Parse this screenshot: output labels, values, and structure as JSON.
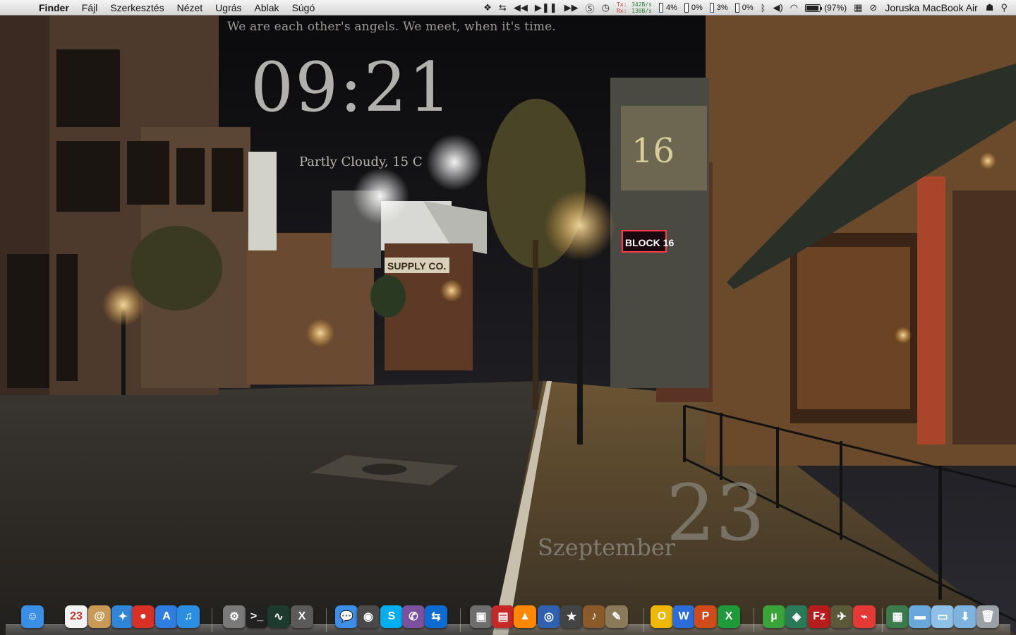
{
  "menubar": {
    "app": "Finder",
    "menus": [
      "Fájl",
      "Szerkesztés",
      "Nézet",
      "Ugrás",
      "Ablak",
      "Súgó"
    ],
    "network": {
      "tx_label": "Tx:",
      "tx_value": "342B/s",
      "rx_label": "Rx:",
      "rx_value": "130B/s"
    },
    "meters": [
      {
        "value": "4%",
        "fill": 0.04
      },
      {
        "value": "0%",
        "fill": 0.0
      },
      {
        "value": "3%",
        "fill": 0.03
      },
      {
        "value": "0%",
        "fill": 0.0
      }
    ],
    "battery": "(97%)",
    "battery_level": 0.97,
    "machine_name": "Joruska MacBook Air",
    "icons": [
      "dropbox-icon",
      "teamviewer-icon",
      "rewind-icon",
      "play-pause-icon",
      "forward-icon",
      "skype-status-icon",
      "time-machine-icon",
      "bluetooth-icon",
      "volume-icon",
      "wifi-icon",
      "calendar-icon",
      "do-not-disturb-icon",
      "user-icon",
      "spotlight-icon"
    ]
  },
  "desktop": {
    "quote": "We are each other's angels. We meet, when it's time.",
    "clock": "09:21",
    "weather": "Partly Cloudy, 15 C",
    "month": "Szeptember",
    "day": "23"
  },
  "dock": {
    "items": [
      {
        "name": "finder-icon",
        "color": "#3a8ee6",
        "glyph": "☺"
      },
      {
        "name": "calendar-icon",
        "color": "#f2f2f2",
        "glyph": "23"
      },
      {
        "name": "address-book-icon",
        "color": "#c89a55",
        "glyph": "@"
      },
      {
        "name": "safari-icon",
        "color": "#2f86d6",
        "glyph": "✦"
      },
      {
        "name": "chrome-icon",
        "color": "#d93025",
        "glyph": "●"
      },
      {
        "name": "app-store-icon",
        "color": "#2f7de0",
        "glyph": "A"
      },
      {
        "name": "itunes-icon",
        "color": "#2b8ee0",
        "glyph": "♫"
      },
      {
        "name": "automator-icon",
        "color": "#7a7a7a",
        "glyph": "⚙"
      },
      {
        "name": "terminal-icon",
        "color": "#222222",
        "glyph": ">_"
      },
      {
        "name": "activity-monitor-icon",
        "color": "#1e3a2e",
        "glyph": "∿"
      },
      {
        "name": "osx-x-icon",
        "color": "#5a5a5a",
        "glyph": "X"
      },
      {
        "name": "messages-icon",
        "color": "#3d8ee8",
        "glyph": "💬"
      },
      {
        "name": "facetime-icon",
        "color": "#4a4a4a",
        "glyph": "◉"
      },
      {
        "name": "skype-icon",
        "color": "#00aff0",
        "glyph": "S"
      },
      {
        "name": "viber-icon",
        "color": "#7b519d",
        "glyph": "✆"
      },
      {
        "name": "teamviewer-icon",
        "color": "#0e6bd2",
        "glyph": "⇆"
      },
      {
        "name": "iphoto-icon",
        "color": "#6e6e6e",
        "glyph": "▣"
      },
      {
        "name": "photo-booth-icon",
        "color": "#c62828",
        "glyph": "▤"
      },
      {
        "name": "vlc-icon",
        "color": "#ff8800",
        "glyph": "▲"
      },
      {
        "name": "dvd-player-icon",
        "color": "#3060b0",
        "glyph": "◎"
      },
      {
        "name": "imovie-icon",
        "color": "#444444",
        "glyph": "★"
      },
      {
        "name": "garageband-icon",
        "color": "#8a5a2a",
        "glyph": "♪"
      },
      {
        "name": "gimp-icon",
        "color": "#8a7a5a",
        "glyph": "✎"
      },
      {
        "name": "office-outlook-icon",
        "color": "#f0b800",
        "glyph": "O"
      },
      {
        "name": "office-word-icon",
        "color": "#2b6cd8",
        "glyph": "W"
      },
      {
        "name": "office-powerpoint-icon",
        "color": "#d04a1a",
        "glyph": "P"
      },
      {
        "name": "office-excel-icon",
        "color": "#1f9a3a",
        "glyph": "X"
      },
      {
        "name": "utorrent-icon",
        "color": "#3aa43a",
        "glyph": "µ"
      },
      {
        "name": "cyberduck-icon",
        "color": "#2a7a5a",
        "glyph": "◈"
      },
      {
        "name": "filezilla-icon",
        "color": "#b71c1c",
        "glyph": "Fz"
      },
      {
        "name": "system-tool-icon",
        "color": "#5a5a3a",
        "glyph": "✈"
      },
      {
        "name": "pdf-reader-icon",
        "color": "#e53935",
        "glyph": "⌁"
      },
      {
        "name": "image-preview-icon",
        "color": "#3b7a4a",
        "glyph": "▦"
      },
      {
        "name": "folder-icon",
        "color": "#6aa8dc",
        "glyph": "▬"
      },
      {
        "name": "documents-folder-icon",
        "color": "#8fc0e8",
        "glyph": "▭"
      },
      {
        "name": "downloads-stack-icon",
        "color": "#7eb3e0",
        "glyph": "⬇"
      },
      {
        "name": "trash-icon",
        "color": "#9aa0a6",
        "glyph": "🗑"
      }
    ]
  }
}
